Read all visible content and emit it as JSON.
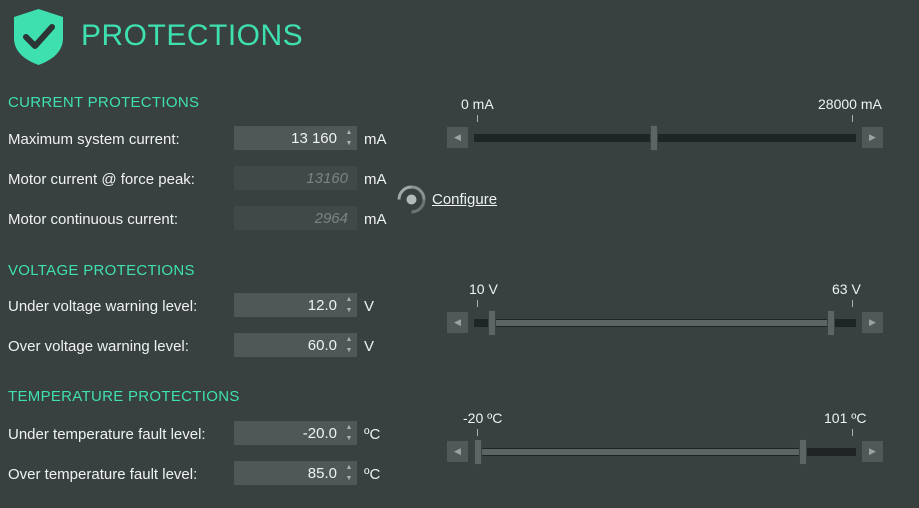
{
  "page": {
    "title": "PROTECTIONS"
  },
  "current": {
    "section_title": "CURRENT PROTECTIONS",
    "rows": [
      {
        "label": "Maximum system current:",
        "value": "13 160",
        "unit": "mA",
        "editable": true
      },
      {
        "label": "Motor current @ force peak:",
        "value": "13160",
        "unit": "mA",
        "editable": false
      },
      {
        "label": "Motor continuous current:",
        "value": "2964",
        "unit": "mA",
        "editable": false
      }
    ],
    "range": {
      "min_label": "0 mA",
      "max_label": "28000 mA",
      "min": 0,
      "max": 28000,
      "value": 13160
    },
    "configure_label": "Configure"
  },
  "voltage": {
    "section_title": "VOLTAGE PROTECTIONS",
    "rows": [
      {
        "label": "Under voltage warning level:",
        "value": "12.0",
        "unit": "V",
        "editable": true
      },
      {
        "label": "Over voltage warning level:",
        "value": "60.0",
        "unit": "V",
        "editable": true
      }
    ],
    "range": {
      "min_label": "10 V",
      "max_label": "63 V",
      "min": 10,
      "max": 63,
      "low": 12,
      "high": 60
    }
  },
  "temperature": {
    "section_title": "TEMPERATURE PROTECTIONS",
    "rows": [
      {
        "label": "Under temperature fault level:",
        "value": "-20.0",
        "unit": "ºC",
        "editable": true
      },
      {
        "label": "Over temperature fault level:",
        "value": "85.0",
        "unit": "ºC",
        "editable": true
      }
    ],
    "range": {
      "min_label": "-20 ºC",
      "max_label": "101 ºC",
      "min": -20,
      "max": 101,
      "low": -20,
      "high": 85
    }
  },
  "icons": {
    "title": "shield-check-icon",
    "spin_up": "caret-up-icon",
    "spin_down": "caret-down-icon",
    "arrow_left": "caret-left-icon",
    "arrow_right": "caret-right-icon",
    "configure": "loading-spinner-icon"
  },
  "colors": {
    "accent": "#3fe0b0",
    "background": "#384040"
  }
}
